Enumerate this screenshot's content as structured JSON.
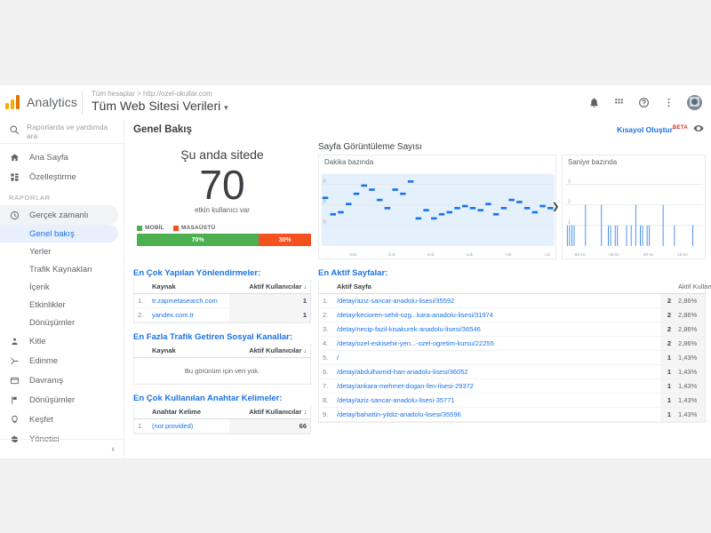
{
  "header": {
    "brand": "Analytics",
    "breadcrumb": "Tüm hesaplar > http://ozel-okullar.com",
    "property": "Tüm Web Sitesi Verileri",
    "property_caret": "▾"
  },
  "sidebar": {
    "search_placeholder": "Raporlarda ve yardımda ara",
    "top_items": [
      {
        "label": "Ana Sayfa",
        "icon": "home-icon"
      },
      {
        "label": "Özelleştirme",
        "icon": "customization-icon"
      }
    ],
    "section_label": "RAPORLAR",
    "realtime": {
      "label": "Gerçek zamanlı",
      "icon": "clock-icon"
    },
    "realtime_children": [
      {
        "label": "Genel bakış",
        "selected": true
      },
      {
        "label": "Yerler",
        "selected": false
      },
      {
        "label": "Trafik Kaynakları",
        "selected": false
      },
      {
        "label": "İçerik",
        "selected": false
      },
      {
        "label": "Etkinlikler",
        "selected": false
      },
      {
        "label": "Dönüşümler",
        "selected": false
      }
    ],
    "bottom_items": [
      {
        "label": "Kitle",
        "icon": "audience-icon"
      },
      {
        "label": "Edinme",
        "icon": "acquisition-icon"
      },
      {
        "label": "Davranış",
        "icon": "behavior-icon"
      },
      {
        "label": "Dönüşümler",
        "icon": "conversions-icon"
      },
      {
        "label": "Keşfet",
        "icon": "discover-icon"
      },
      {
        "label": "Yönetici",
        "icon": "admin-icon"
      }
    ],
    "collapse": "‹"
  },
  "content": {
    "page_title": "Genel Bakış",
    "shortcut_label": "Kısayol Oluştur",
    "shortcut_beta": "BETA"
  },
  "counter": {
    "label": "Şu anda sitede",
    "value": "70",
    "sublabel": "etkin kullanıcı var",
    "legend": [
      {
        "name": "MOBİL",
        "color": "#4CAF50"
      },
      {
        "name": "MASAÜSTÜ",
        "color": "#F4511E"
      }
    ],
    "segments": [
      {
        "label": "70%",
        "pct": 70,
        "color": "#4CAF50"
      },
      {
        "label": "30%",
        "pct": 30,
        "color": "#F4511E"
      }
    ]
  },
  "chart_data": [
    {
      "type": "bar",
      "title": "Sayfa Görüntüleme Sayısı",
      "subtitle": "Dakika bazında",
      "xlabel": "",
      "ylabel": "",
      "ylim": [
        0,
        35
      ],
      "yticks": [
        10,
        20,
        30
      ],
      "xticks": [
        "-26 dk.",
        "-21 dk.",
        "-16 dk.",
        "-11 dk.",
        "-6 dk.",
        "-1 dk."
      ],
      "grid": true,
      "bar_color": "#1a73e8",
      "area_color": "#e4f0fb",
      "categories": [
        "-30",
        "-29",
        "-28",
        "-27",
        "-26",
        "-25",
        "-24",
        "-23",
        "-22",
        "-21",
        "-20",
        "-19",
        "-18",
        "-17",
        "-16",
        "-15",
        "-14",
        "-13",
        "-12",
        "-11",
        "-10",
        "-9",
        "-8",
        "-7",
        "-6",
        "-5",
        "-4",
        "-3",
        "-2",
        "-1"
      ],
      "values": [
        24,
        16,
        17,
        21,
        26,
        30,
        28,
        23,
        19,
        28,
        26,
        32,
        14,
        18,
        14,
        16,
        17,
        19,
        20,
        19,
        18,
        21,
        16,
        19,
        23,
        22,
        19,
        17,
        20,
        19
      ]
    },
    {
      "type": "bar",
      "title": "",
      "subtitle": "Saniye bazında",
      "xlabel": "",
      "ylabel": "",
      "ylim": [
        0,
        3.5
      ],
      "yticks": [
        1,
        2,
        3
      ],
      "xticks": [
        "-60 sn.",
        "-45 sn.",
        "-30 sn.",
        "-15 sn."
      ],
      "grid": true,
      "bar_color": "#1a73e8",
      "categories": [
        "-60",
        "-59",
        "-58",
        "-57",
        "-56",
        "-55",
        "-54",
        "-53",
        "-52",
        "-51",
        "-50",
        "-49",
        "-48",
        "-47",
        "-46",
        "-45",
        "-44",
        "-43",
        "-42",
        "-41",
        "-40",
        "-39",
        "-38",
        "-37",
        "-36",
        "-35",
        "-34",
        "-33",
        "-32",
        "-31",
        "-30",
        "-29",
        "-28",
        "-27",
        "-26",
        "-25",
        "-24",
        "-23",
        "-22",
        "-21",
        "-20",
        "-19",
        "-18",
        "-17",
        "-16",
        "-15",
        "-14",
        "-13",
        "-12",
        "-11",
        "-10",
        "-9",
        "-8",
        "-7",
        "-6",
        "-5",
        "-4",
        "-3",
        "-2",
        "-1"
      ],
      "values": [
        1,
        1,
        1,
        1,
        0,
        0,
        0,
        0,
        2,
        0,
        0,
        0,
        0,
        0,
        0,
        2,
        0,
        0,
        1,
        1,
        0,
        1,
        1,
        0,
        0,
        0,
        1,
        0,
        1,
        0,
        2,
        0,
        1,
        1,
        0,
        1,
        1,
        0,
        0,
        0,
        0,
        0,
        2,
        0,
        0,
        0,
        0,
        1,
        0,
        0,
        0,
        0,
        0,
        0,
        0,
        1,
        0,
        0,
        0,
        0
      ]
    }
  ],
  "referrals": {
    "title": "En Çok Yapılan Yönlendirmeler:",
    "columns": [
      "Kaynak",
      "Aktif Kullanıcılar"
    ],
    "sort_arrow": "↓",
    "rows": [
      {
        "index": "1.",
        "source": "tr.zapmetasearch.com",
        "users": "1"
      },
      {
        "index": "2.",
        "source": "yandex.com.tr",
        "users": "1"
      }
    ]
  },
  "social": {
    "title": "En Fazla Trafik Getiren Sosyal Kanallar:",
    "columns": [
      "Kaynak",
      "Aktif Kullanıcılar"
    ],
    "sort_arrow": "↓",
    "empty_message": "Bu görünüm için veri yok."
  },
  "keywords": {
    "title": "En Çok Kullanılan Anahtar Kelimeler:",
    "columns": [
      "Anahtar Kelime",
      "Aktif Kullanıcılar"
    ],
    "sort_arrow": "↓",
    "rows": [
      {
        "index": "1.",
        "keyword": "(not provided)",
        "users": "66"
      }
    ]
  },
  "active_pages": {
    "title": "En Aktif Sayfalar:",
    "columns": [
      "Aktif Sayfa",
      "Aktif Kullanıcılar"
    ],
    "sort_arrow": "↓",
    "rows": [
      {
        "index": "1.",
        "page": "/detay/aziz-sancar-anadolu-lisesi/35592",
        "users": "2",
        "pct": "2,86%"
      },
      {
        "index": "2.",
        "page": "/detay/kecioren-sehit-ozg...kara-anadolu-lisesi/31974",
        "users": "2",
        "pct": "2,86%"
      },
      {
        "index": "3.",
        "page": "/detay/necip-fazil-kisakurek-anadolu-lisesi/36546",
        "users": "2",
        "pct": "2,86%"
      },
      {
        "index": "4.",
        "page": "/detay/ozel-eskisehir-yen...-ozel-ogretim-kursu/22255",
        "users": "2",
        "pct": "2,86%"
      },
      {
        "index": "5.",
        "page": "/",
        "users": "1",
        "pct": "1,43%"
      },
      {
        "index": "6.",
        "page": "/detay/abdulhamid-han-anadolu-lisesi/36052",
        "users": "1",
        "pct": "1,43%"
      },
      {
        "index": "7.",
        "page": "/detay/ankara-mehmet-dogan-fen-lisesi-29372",
        "users": "1",
        "pct": "1,43%"
      },
      {
        "index": "8.",
        "page": "/detay/aziz-sancar-anadolu-lisesi-35771",
        "users": "1",
        "pct": "1,43%"
      },
      {
        "index": "9.",
        "page": "/detay/bahattin-yildiz-anadolu-lisesi/35596",
        "users": "1",
        "pct": "1,43%"
      }
    ]
  }
}
